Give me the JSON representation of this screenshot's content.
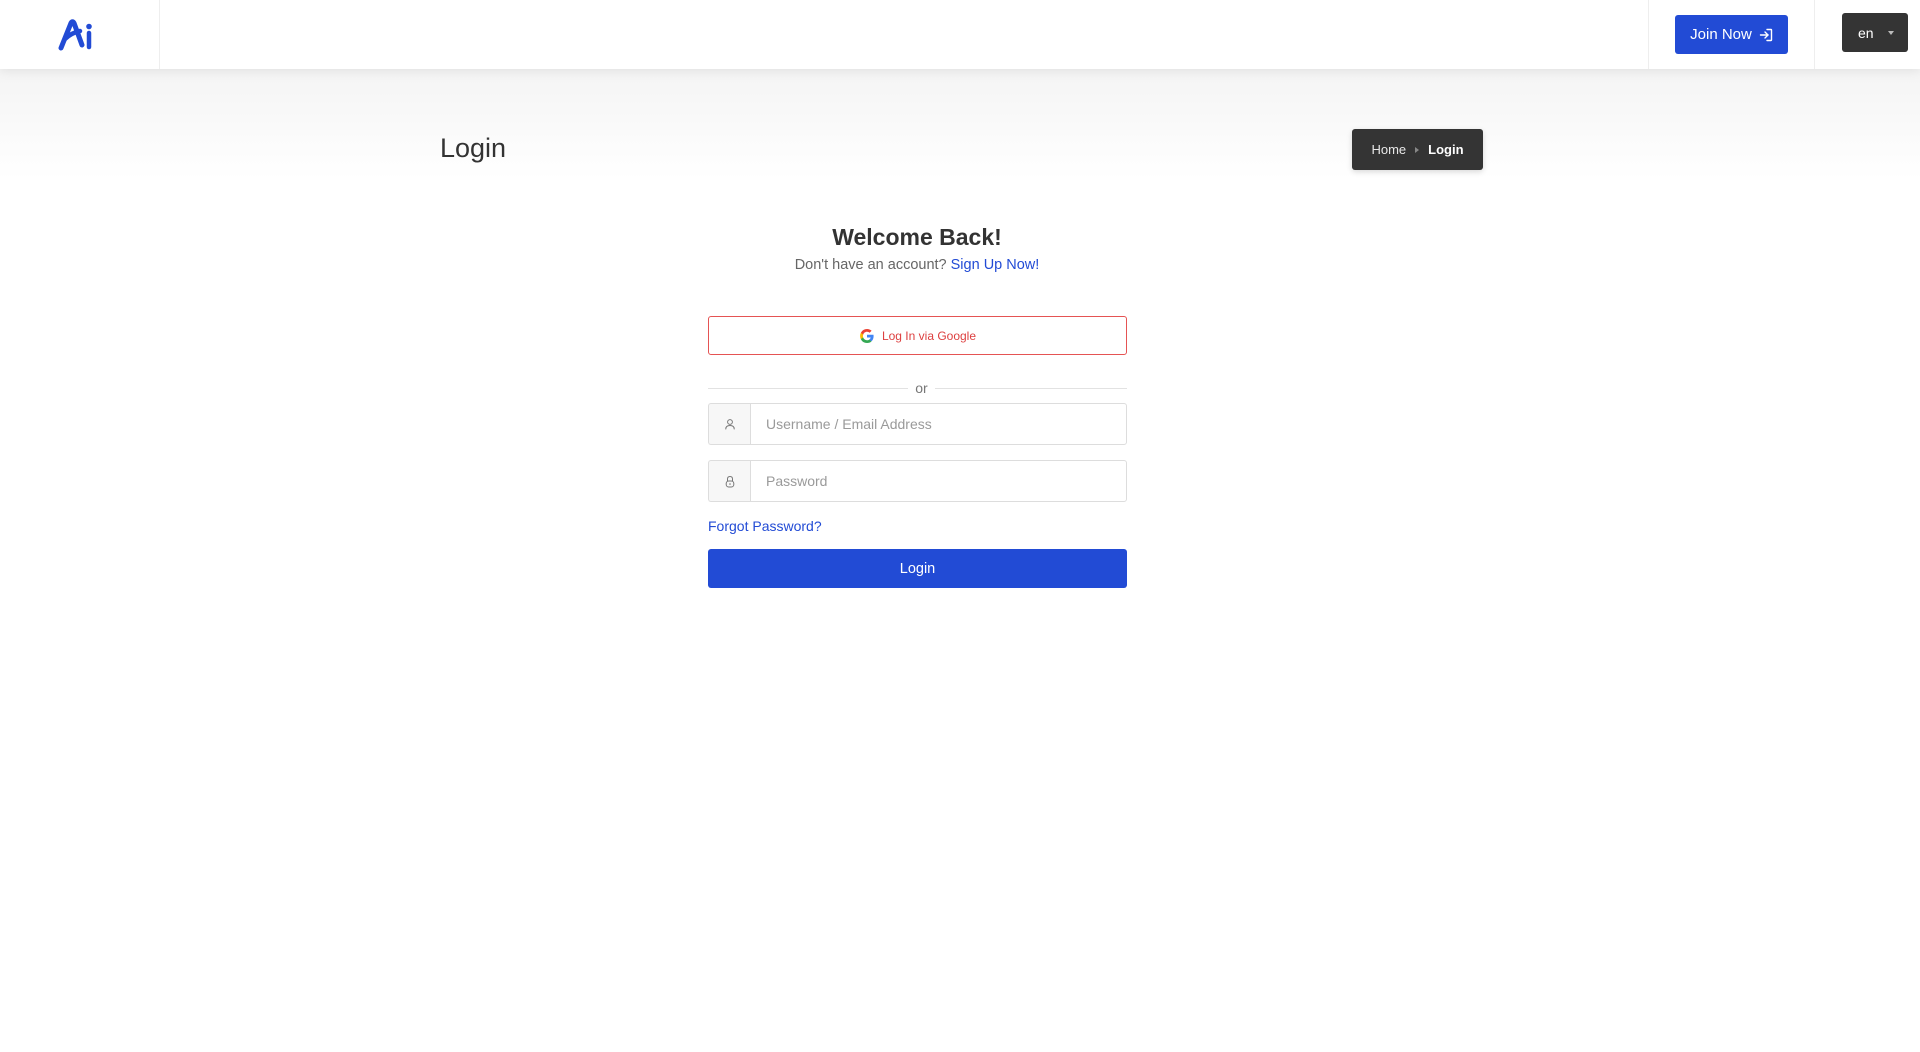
{
  "header": {
    "logo_alt": "Ai",
    "join_label": "Join Now",
    "language": "en"
  },
  "page": {
    "title": "Login"
  },
  "breadcrumb": {
    "home": "Home",
    "current": "Login"
  },
  "form": {
    "heading": "Welcome Back!",
    "no_account_text": "Don't have an account?",
    "signup_link": "Sign Up Now!",
    "google_label": "Log In via Google",
    "divider_text": "or",
    "username_placeholder": "Username / Email Address",
    "password_placeholder": "Password",
    "forgot_link": "Forgot Password?",
    "submit_label": "Login"
  },
  "icons": {
    "logo": "ai-logo-icon",
    "join": "sign-in-arrow-icon",
    "language_caret": "caret-down-icon",
    "breadcrumb_separator": "chevron-right-icon",
    "google": "google-g-icon",
    "username": "user-icon",
    "password": "lock-icon"
  },
  "colors": {
    "primary": "#224bd5",
    "dark": "#343434",
    "google_red": "#e55353"
  }
}
